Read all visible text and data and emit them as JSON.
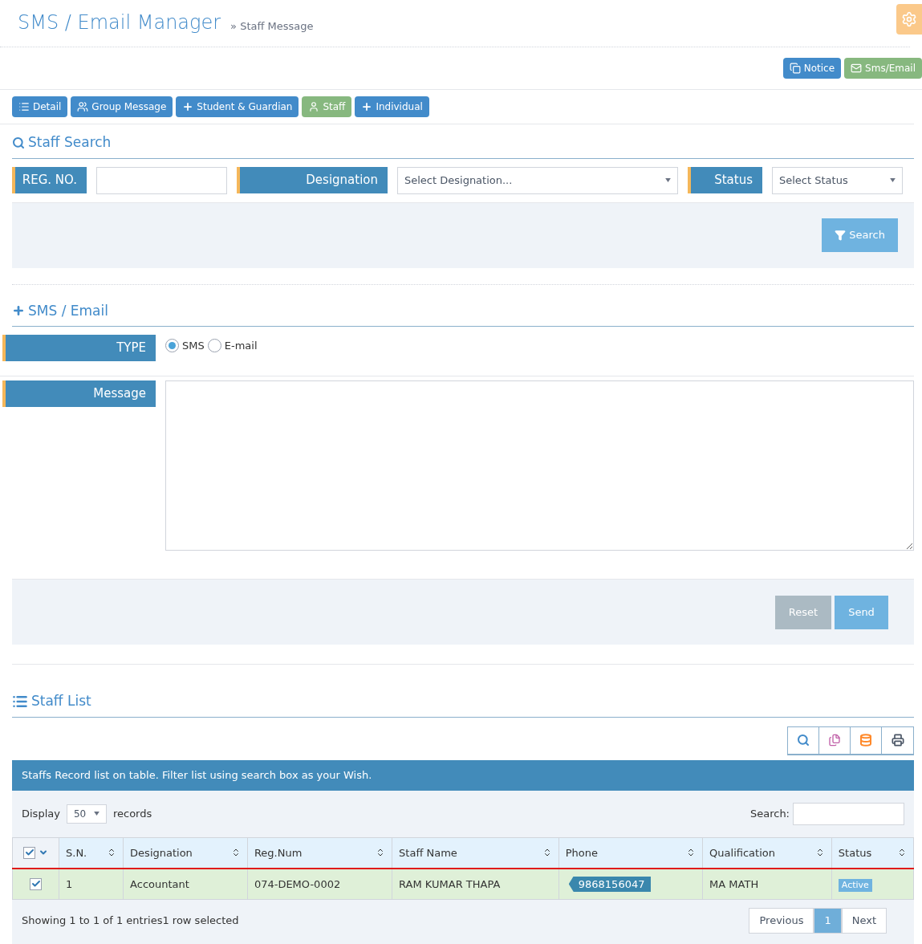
{
  "header": {
    "title": "SMS / Email Manager",
    "breadcrumb": "» Staff Message"
  },
  "top_buttons": [
    {
      "label": "Notice",
      "kind": "copy",
      "selected": false
    },
    {
      "label": "Sms/Email",
      "kind": "envelope",
      "selected": true
    }
  ],
  "tabs": [
    {
      "label": "Detail",
      "kind": "list",
      "selected": false
    },
    {
      "label": "Group Message",
      "kind": "users",
      "selected": false
    },
    {
      "label": "Student & Guardian",
      "kind": "plus",
      "selected": false
    },
    {
      "label": "Staff",
      "kind": "user",
      "selected": true
    },
    {
      "label": "Individual",
      "kind": "plus",
      "selected": false
    }
  ],
  "staff_search": {
    "title": "Staff Search",
    "reg_label": "REG. NO.",
    "designation_label": "Designation",
    "designation_placeholder": "Select Designation...",
    "status_label": "Status",
    "status_placeholder": "Select Status",
    "search_button": "Search"
  },
  "sms_email": {
    "title": "SMS / Email",
    "type_label": "TYPE",
    "types": [
      {
        "label": "SMS",
        "selected": true
      },
      {
        "label": "E-mail",
        "selected": false
      }
    ],
    "message_label": "Message",
    "reset_button": "Reset",
    "send_button": "Send"
  },
  "staff_list": {
    "title": "Staff List",
    "banner": "Staffs Record list on table. Filter list using search box as your Wish.",
    "display_label": "Display",
    "display_value": "50",
    "records_label": "records",
    "search_label": "Search:",
    "header_checked": true,
    "columns": [
      "S.N.",
      "Designation",
      "Reg.Num",
      "Staff Name",
      "Phone",
      "Qualification",
      "Status"
    ],
    "rows": [
      {
        "checked": true,
        "selected": true,
        "cells": [
          "1",
          "Accountant",
          "074-DEMO-0002",
          "RAM KUMAR THAPA",
          "9868156047",
          "MA MATH",
          "Active"
        ]
      }
    ],
    "info": "Showing 1 to 1 of 1 entries1 row selected",
    "pagination": [
      {
        "label": "Previous",
        "selected": false
      },
      {
        "label": "1",
        "selected": true
      },
      {
        "label": "Next",
        "selected": false
      }
    ]
  }
}
